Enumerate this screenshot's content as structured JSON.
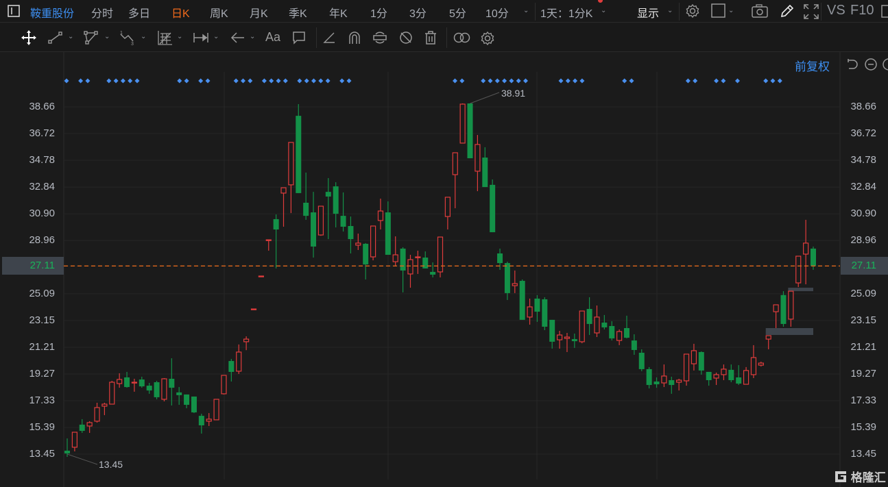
{
  "toolbar": {
    "stock_name": "鞍重股份",
    "periods": [
      "分时",
      "多日",
      "日K",
      "周K",
      "月K",
      "季K",
      "年K",
      "1分",
      "3分",
      "5分",
      "10分"
    ],
    "active_period": "日K",
    "range_select": "1天：1分K",
    "display_label": "显示",
    "vs_label": "VS",
    "f10_label": "F10"
  },
  "drawing_tools": [
    "move",
    "line",
    "polyline",
    "wave",
    "fib-grid",
    "measure",
    "arrow",
    "text",
    "comment",
    "angle",
    "magnet",
    "sync",
    "hide",
    "delete",
    "overlay",
    "settings"
  ],
  "text_tool_label": "Aa",
  "adjust_label": "前复权",
  "colors": {
    "up": "#e03c3c",
    "down": "#139148",
    "accent": "#3d8ef0",
    "active": "#f26a1b",
    "last_price_line": "#e0661c"
  },
  "chart_data": {
    "type": "candlestick",
    "price_ticks": [
      "38.66",
      "36.72",
      "34.78",
      "32.84",
      "30.90",
      "28.96",
      "27.11",
      "25.09",
      "23.15",
      "21.21",
      "19.27",
      "17.33",
      "15.39",
      "13.45"
    ],
    "last_price": "27.11",
    "high_label": "38.91",
    "low_label": "13.45",
    "high_index": 54,
    "low_index": 0,
    "ylim": [
      13.45,
      38.66
    ],
    "candles_ohlc": [
      [
        13.7,
        14.59,
        13.25,
        13.5
      ],
      [
        13.95,
        15.04,
        13.65,
        15.04
      ],
      [
        15.59,
        15.99,
        14.99,
        15.14
      ],
      [
        15.49,
        15.84,
        14.99,
        15.74
      ],
      [
        15.84,
        17.18,
        15.74,
        16.83
      ],
      [
        16.93,
        17.18,
        16.28,
        17.08
      ],
      [
        17.08,
        18.77,
        17.08,
        18.67
      ],
      [
        18.57,
        19.32,
        18.27,
        18.87
      ],
      [
        19.02,
        19.42,
        18.27,
        18.32
      ],
      [
        18.62,
        18.92,
        17.98,
        18.67
      ],
      [
        18.87,
        19.07,
        18.27,
        18.37
      ],
      [
        18.42,
        18.62,
        17.83,
        18.07
      ],
      [
        18.67,
        18.77,
        17.43,
        17.58
      ],
      [
        17.43,
        18.97,
        17.28,
        18.92
      ],
      [
        18.92,
        20.41,
        16.98,
        18.27
      ],
      [
        17.93,
        18.32,
        17.03,
        17.73
      ],
      [
        17.78,
        17.78,
        16.78,
        17.03
      ],
      [
        17.63,
        17.63,
        16.43,
        16.48
      ],
      [
        16.23,
        16.38,
        14.94,
        15.54
      ],
      [
        15.84,
        16.43,
        15.49,
        15.99
      ],
      [
        15.94,
        17.43,
        15.94,
        17.43
      ],
      [
        17.83,
        19.17,
        17.78,
        19.17
      ],
      [
        20.21,
        20.36,
        18.72,
        19.42
      ],
      [
        19.47,
        21.41,
        19.27,
        20.86
      ],
      [
        21.61,
        22.0,
        21.0,
        21.8
      ],
      [
        23.99,
        23.99,
        23.99,
        23.99
      ],
      [
        26.38,
        26.38,
        26.38,
        26.38
      ],
      [
        29.01,
        29.01,
        28.22,
        29.01
      ],
      [
        30.51,
        30.85,
        26.93,
        29.76
      ],
      [
        32.4,
        32.79,
        29.96,
        32.79
      ],
      [
        33.0,
        36.08,
        30.95,
        36.08
      ],
      [
        38.01,
        38.86,
        32.4,
        32.4
      ],
      [
        31.7,
        33.89,
        30.46,
        30.75
      ],
      [
        31.0,
        32.49,
        27.72,
        28.52
      ],
      [
        29.36,
        31.45,
        29.3,
        31.45
      ],
      [
        32.49,
        33.49,
        29.06,
        32.15
      ],
      [
        32.89,
        33.19,
        29.91,
        30.9
      ],
      [
        30.75,
        32.45,
        29.61,
        29.96
      ],
      [
        30.01,
        30.7,
        28.02,
        29.06
      ],
      [
        28.62,
        29.46,
        28.27,
        28.77
      ],
      [
        28.72,
        28.77,
        26.13,
        27.22
      ],
      [
        27.77,
        30.01,
        27.52,
        30.01
      ],
      [
        30.41,
        32.0,
        29.76,
        31.1
      ],
      [
        31.0,
        31.8,
        27.92,
        27.92
      ],
      [
        27.42,
        29.26,
        27.1,
        27.92
      ],
      [
        28.37,
        28.47,
        25.19,
        26.78
      ],
      [
        26.53,
        27.92,
        25.53,
        27.57
      ],
      [
        27.72,
        28.22,
        26.53,
        27.77
      ],
      [
        27.72,
        28.17,
        26.93,
        26.93
      ],
      [
        26.68,
        27.37,
        26.28,
        26.48
      ],
      [
        26.68,
        29.21,
        26.28,
        29.21
      ],
      [
        30.7,
        32.1,
        29.76,
        32.1
      ],
      [
        33.74,
        35.33,
        31.3,
        35.33
      ],
      [
        36.03,
        38.91,
        36.03,
        38.86
      ],
      [
        38.91,
        38.91,
        34.93,
        34.93
      ],
      [
        33.99,
        36.62,
        32.54,
        35.93
      ],
      [
        34.98,
        35.73,
        32.84,
        32.84
      ],
      [
        33.0,
        33.39,
        29.56,
        29.56
      ],
      [
        28.02,
        28.37,
        26.83,
        27.32
      ],
      [
        27.32,
        27.42,
        24.64,
        25.14
      ],
      [
        25.68,
        26.78,
        25.14,
        25.83
      ],
      [
        26.03,
        26.13,
        23.2,
        23.2
      ],
      [
        23.4,
        24.74,
        22.85,
        24.14
      ],
      [
        24.74,
        24.99,
        23.05,
        23.79
      ],
      [
        24.69,
        24.84,
        22.45,
        22.7
      ],
      [
        23.2,
        23.2,
        21.11,
        21.61
      ],
      [
        21.75,
        22.4,
        21.11,
        22.1
      ],
      [
        21.85,
        22.25,
        20.86,
        21.95
      ],
      [
        21.8,
        22.2,
        21.16,
        21.65
      ],
      [
        21.61,
        23.84,
        21.5,
        23.84
      ],
      [
        23.99,
        24.84,
        22.1,
        22.9
      ],
      [
        22.25,
        24.24,
        21.95,
        23.4
      ],
      [
        23.0,
        23.55,
        22.5,
        22.65
      ],
      [
        22.75,
        23.1,
        21.7,
        21.85
      ],
      [
        21.7,
        22.5,
        21.36,
        22.35
      ],
      [
        22.6,
        23.5,
        21.85,
        21.9
      ],
      [
        21.7,
        22.15,
        20.66,
        21.01
      ],
      [
        20.81,
        21.06,
        19.47,
        19.62
      ],
      [
        19.62,
        19.77,
        18.22,
        18.47
      ],
      [
        18.72,
        19.02,
        18.27,
        18.52
      ],
      [
        18.62,
        19.96,
        18.32,
        19.12
      ],
      [
        18.82,
        19.07,
        17.83,
        18.47
      ],
      [
        18.67,
        18.92,
        18.07,
        18.82
      ],
      [
        18.77,
        20.71,
        18.42,
        20.71
      ],
      [
        20.01,
        21.46,
        19.52,
        20.96
      ],
      [
        20.86,
        20.91,
        19.22,
        19.52
      ],
      [
        19.42,
        19.42,
        18.42,
        18.82
      ],
      [
        18.97,
        19.37,
        18.47,
        19.22
      ],
      [
        19.22,
        19.96,
        18.82,
        19.62
      ],
      [
        19.57,
        19.96,
        18.67,
        18.82
      ],
      [
        19.02,
        19.91,
        18.47,
        18.57
      ],
      [
        18.52,
        19.77,
        18.52,
        19.52
      ],
      [
        19.22,
        21.36,
        18.97,
        20.46
      ],
      [
        19.91,
        20.16,
        19.81,
        20.06
      ],
      [
        21.8,
        22.05,
        21.06,
        22.05
      ],
      [
        23.79,
        24.29,
        22.6,
        24.29
      ],
      [
        25.0,
        25.28,
        22.7,
        22.9
      ],
      [
        23.25,
        25.28,
        22.7,
        25.28
      ],
      [
        25.88,
        27.82,
        25.58,
        27.82
      ],
      [
        27.97,
        30.46,
        25.78,
        28.77
      ],
      [
        28.37,
        28.52,
        26.83,
        27.11
      ]
    ],
    "event_marker_slots": [
      0,
      2,
      3,
      6,
      7,
      8,
      9,
      10,
      16,
      17,
      19,
      20,
      24,
      25,
      26,
      28,
      29,
      30,
      31,
      33,
      34,
      35,
      36,
      37,
      39,
      40,
      55,
      56,
      59,
      60,
      61,
      62,
      63,
      64,
      65,
      70,
      71,
      72,
      73,
      79,
      80,
      88,
      89,
      92,
      93,
      95,
      99,
      100,
      101
    ],
    "zones": [
      {
        "from_index": 94,
        "to_index": 100,
        "low": 22.1,
        "high": 22.6
      },
      {
        "from_index": 97,
        "to_index": 100,
        "low": 25.28,
        "high": 25.53
      }
    ]
  },
  "watermark": "格隆汇"
}
